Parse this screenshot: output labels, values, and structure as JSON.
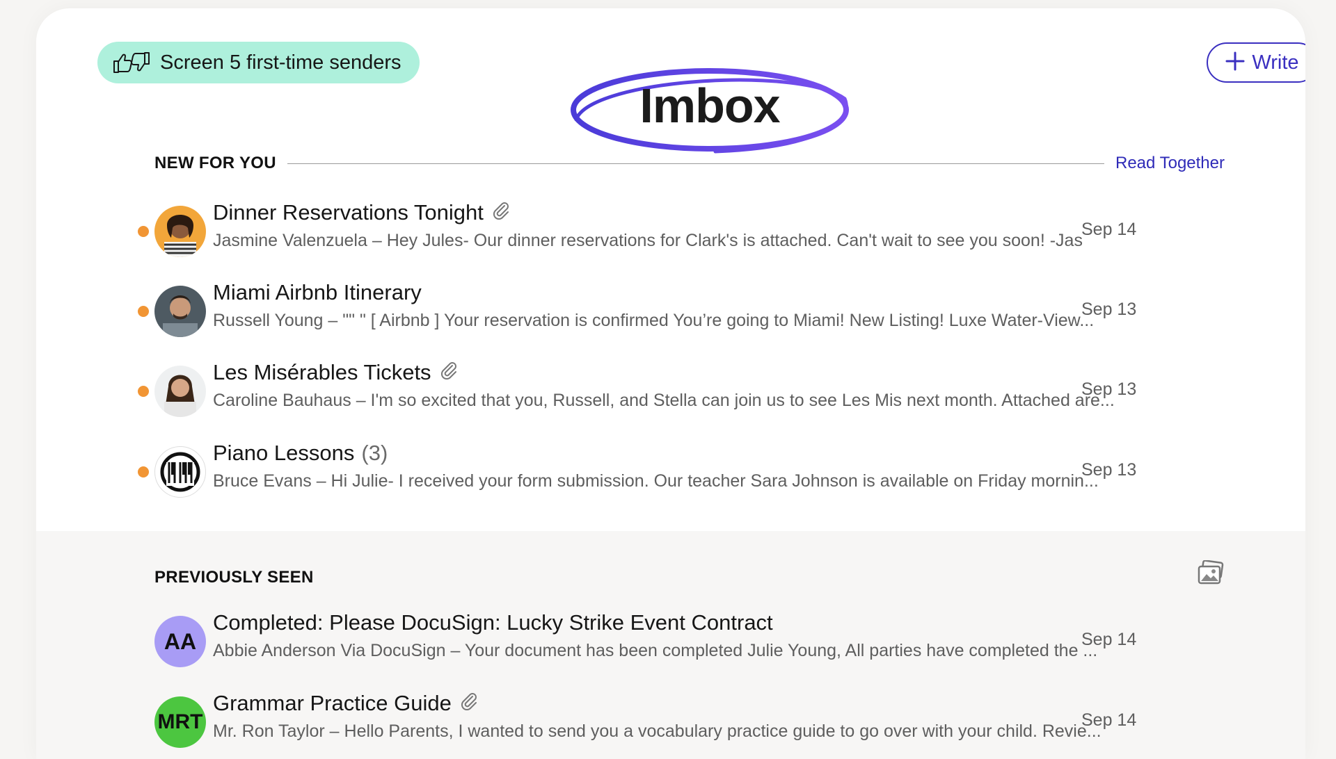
{
  "screener": {
    "label": "Screen 5 first-time senders",
    "icon": "thumbs-up-down-icon"
  },
  "write_button": {
    "label": "Write",
    "icon": "plus-icon"
  },
  "title": "Imbox",
  "colors": {
    "accent": "#3a2fc0",
    "unread_dot": "#f19534",
    "screener_bg": "#aef0dc"
  },
  "new_for_you": {
    "label": "NEW FOR YOU",
    "read_together": "Read Together",
    "items": [
      {
        "subject": "Dinner Reservations Tonight",
        "attachment": true,
        "count": "",
        "sender": "Jasmine Valenzuela",
        "separator": " – ",
        "snippet": "Hey Jules- Our dinner reservations for Clark's is attached. Can't wait to see you soon! -Jas",
        "date": "Sep 14"
      },
      {
        "subject": "Miami Airbnb Itinerary",
        "attachment": false,
        "count": "",
        "sender": "Russell Young",
        "separator": " – ",
        "snippet": "\"\" \" [ Airbnb ] Your reservation is confirmed You’re going to Miami! New Listing! Luxe Water-View...",
        "date": "Sep 13"
      },
      {
        "subject": "Les Misérables Tickets",
        "attachment": true,
        "count": "",
        "sender": "Caroline Bauhaus",
        "separator": " – ",
        "snippet": "I'm so excited that you, Russell, and Stella can join us to see Les Mis next month. Attached are...",
        "date": "Sep 13"
      },
      {
        "subject": "Piano Lessons",
        "attachment": false,
        "count": "(3)",
        "sender": "Bruce Evans",
        "separator": " – ",
        "snippet": "Hi Julie- I received your form submission. Our teacher Sara Johnson is available on Friday mornin...",
        "date": "Sep 13"
      }
    ]
  },
  "previously_seen": {
    "label": "PREVIOUSLY SEEN",
    "icon": "photos-icon",
    "items": [
      {
        "initials": "AA",
        "avatar_color": "#a89cf5",
        "subject": "Completed: Please DocuSign: Lucky Strike Event Contract",
        "attachment": false,
        "sender": "Abbie Anderson Via DocuSign",
        "separator": " – ",
        "snippet": "Your document has been completed Julie Young, All parties have completed the ...",
        "date": "Sep 14"
      },
      {
        "initials": "MRT",
        "avatar_color": "#4cc640",
        "subject": "Grammar Practice Guide",
        "attachment": true,
        "sender": "Mr. Ron Taylor",
        "separator": " – ",
        "snippet": "Hello Parents, I wanted to send you a vocabulary practice guide to go over with your child. Revie...",
        "date": "Sep 14"
      }
    ]
  }
}
